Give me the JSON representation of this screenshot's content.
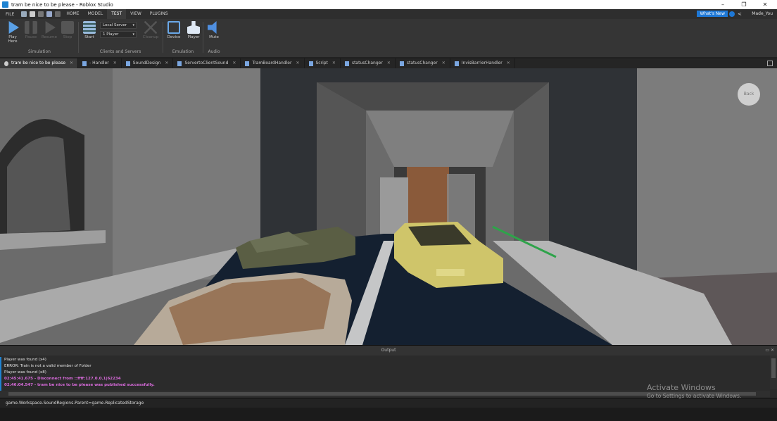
{
  "window": {
    "title": "tram be nice to be please - Roblox Studio",
    "minimize": "–",
    "maximize": "❐",
    "close": "✕"
  },
  "menu": {
    "file": "FILE",
    "tabs": [
      "HOME",
      "MODEL",
      "TEST",
      "VIEW",
      "PLUGINS"
    ],
    "active_tab": "TEST",
    "whats_new": "What's New",
    "user": "Made_You"
  },
  "ribbon": {
    "play_label": "Play",
    "play_sub": "Here",
    "pause": "Pause",
    "resume": "Resume",
    "stop": "Stop",
    "simulation_group": "Simulation",
    "start": "Start",
    "server_dropdown": "Local Server",
    "players_dropdown": "1 Player",
    "cleanup": "Cleanup",
    "clients_group": "Clients and Servers",
    "device": "Device",
    "player": "Player",
    "emulation_group": "Emulation",
    "mute": "Mute",
    "audio_group": "Audio"
  },
  "doc_tabs": [
    "tram be nice to be please",
    "- Handler",
    "SoundDesign",
    "ServertoClientSound",
    "TramBoardHandler",
    "Script",
    "statusChanger",
    "statusChanger",
    "InvisBarrierHandler"
  ],
  "viewport": {
    "back_button": "Back"
  },
  "output": {
    "title": "Output",
    "lines": [
      {
        "text": "Player was found (x4)",
        "style": "normal"
      },
      {
        "text": "ERROR: Train is not a valid member of Folder",
        "style": "normal"
      },
      {
        "text": "Player was found (x8)",
        "style": "normal"
      },
      {
        "text": "02:45:41.675 - Disconnect from ::ffff:127.0.0.1|62234",
        "style": "pink"
      },
      {
        "text": "02:46:04.547 - tram be nice to be please was published successfully.",
        "style": "pink"
      }
    ]
  },
  "command_bar": {
    "value": "game.Workspace.SoundRegions.Parent=game.ReplicatedStorage"
  },
  "watermark": {
    "line1": "Activate Windows",
    "line2": "Go to Settings to activate Windows."
  },
  "colors": {
    "accent": "#1f83d2",
    "output_pink": "#d96bdc"
  }
}
